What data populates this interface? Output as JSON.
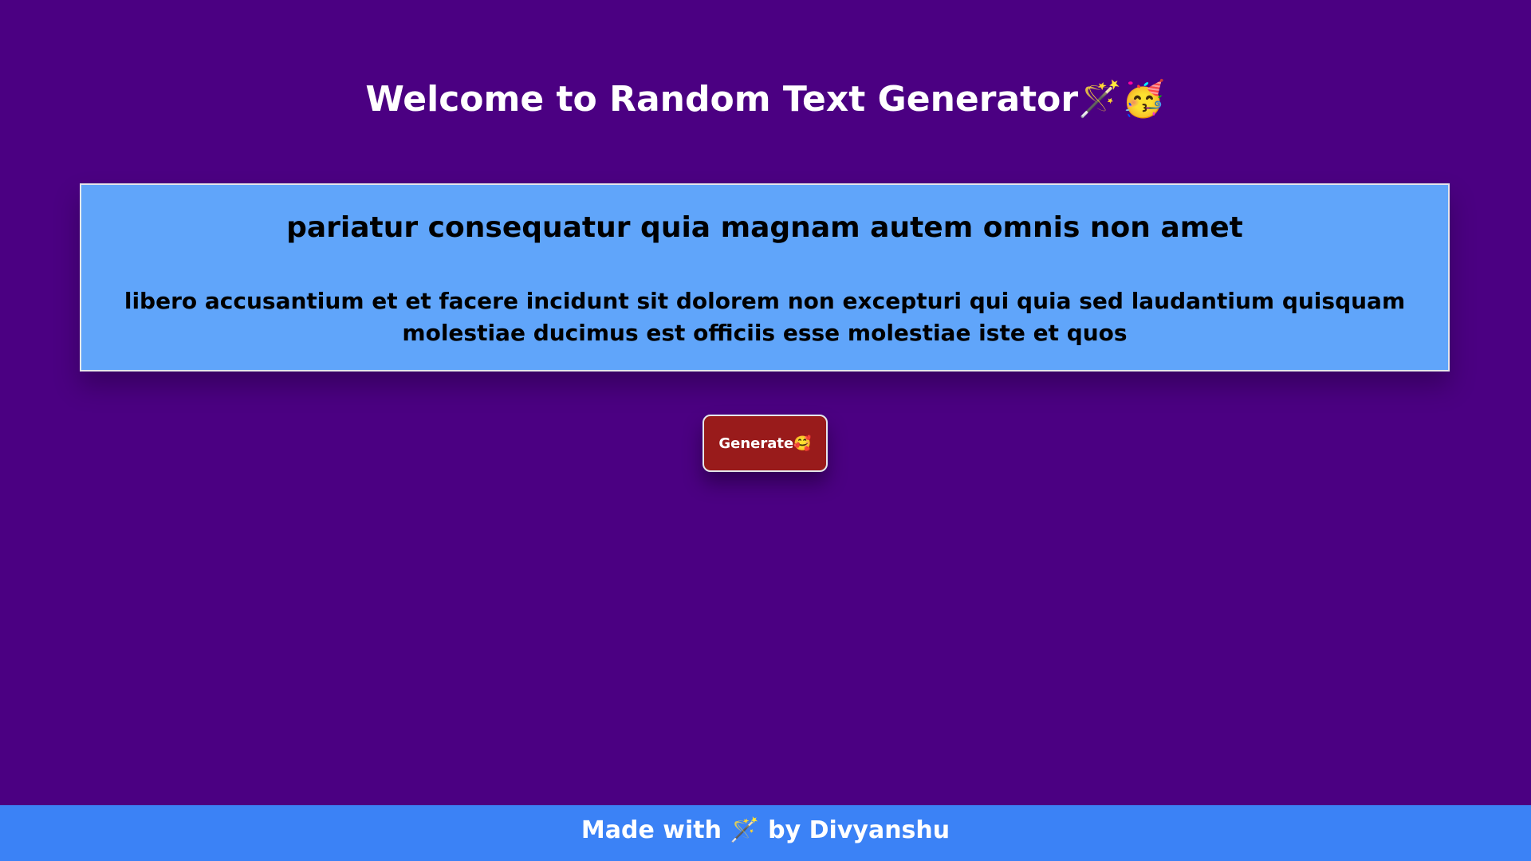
{
  "header": {
    "title": "Welcome to Random Text Generator🪄🥳"
  },
  "card": {
    "heading": "pariatur consequatur quia magnam autem omnis non amet",
    "paragraph": "libero accusantium et et facere incidunt sit dolorem non excepturi qui quia sed laudantium quisquam molestiae ducimus est officiis esse molestiae iste et quos"
  },
  "actions": {
    "generate_label": "Generate🥰"
  },
  "footer": {
    "text": "Made with 🪄 by Divyanshu"
  },
  "colors": {
    "background": "#4b0082",
    "card": "#60a5fa",
    "button": "#991b1b",
    "footer": "#3b82f6"
  }
}
